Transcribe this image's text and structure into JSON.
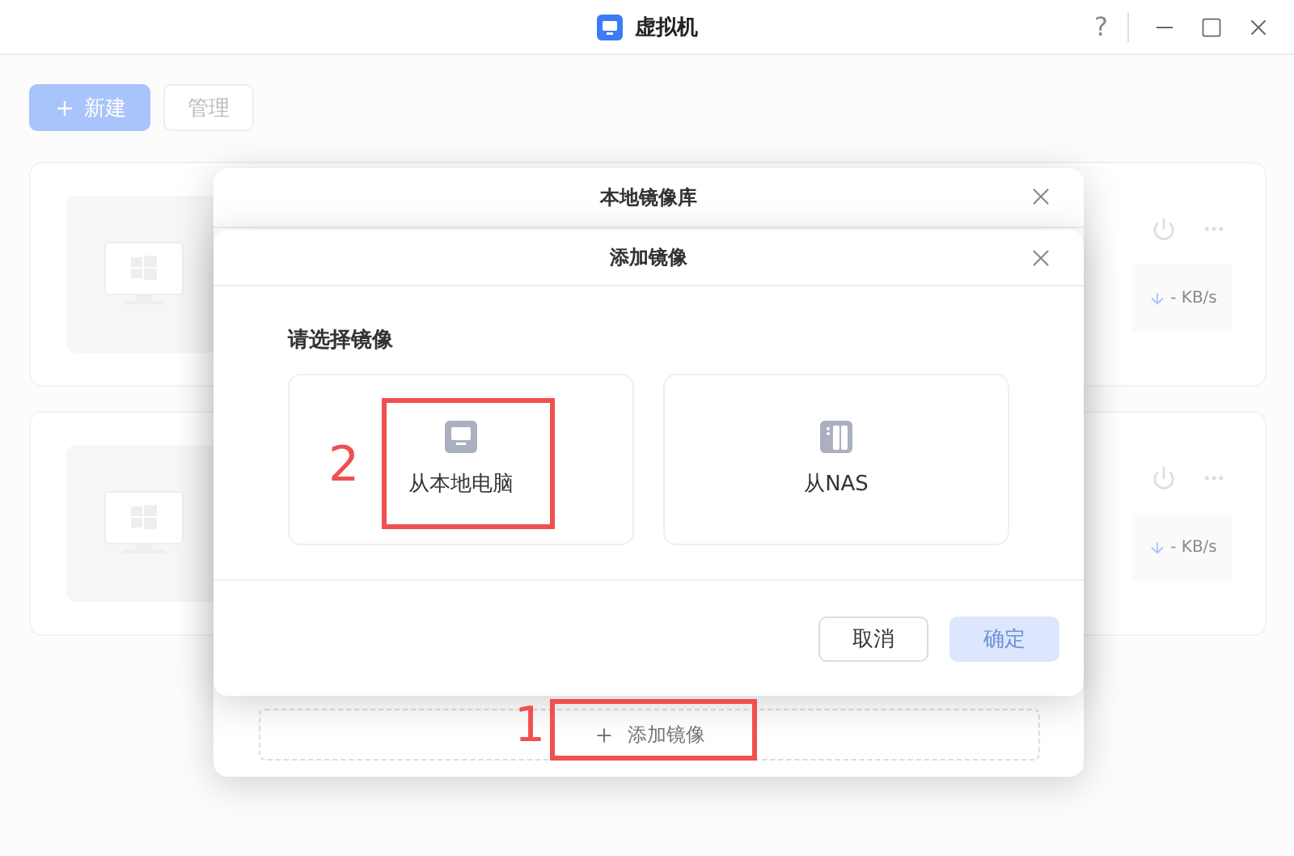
{
  "window": {
    "title": "虚拟机",
    "help": "?"
  },
  "toolbar": {
    "buttons": [
      {
        "label": "新建",
        "kind": "primary"
      },
      {
        "label": "管理",
        "kind": "default"
      }
    ]
  },
  "vm_cards": [
    {
      "speed": "- KB/s"
    },
    {
      "speed": "- KB/s"
    }
  ],
  "library_dialog": {
    "title": "本地镜像库",
    "add_button": "添加镜像"
  },
  "add_dialog": {
    "title": "添加镜像",
    "prompt": "请选择镜像",
    "options": [
      {
        "label": "从本地电脑",
        "kind": "computer"
      },
      {
        "label": "从NAS",
        "kind": "nas"
      }
    ],
    "buttons": [
      {
        "label": "取消",
        "kind": "default",
        "disabled": false
      },
      {
        "label": "确定",
        "kind": "primary",
        "disabled": true
      }
    ]
  },
  "annotations": [
    {
      "label": "1"
    },
    {
      "label": "2"
    }
  ]
}
